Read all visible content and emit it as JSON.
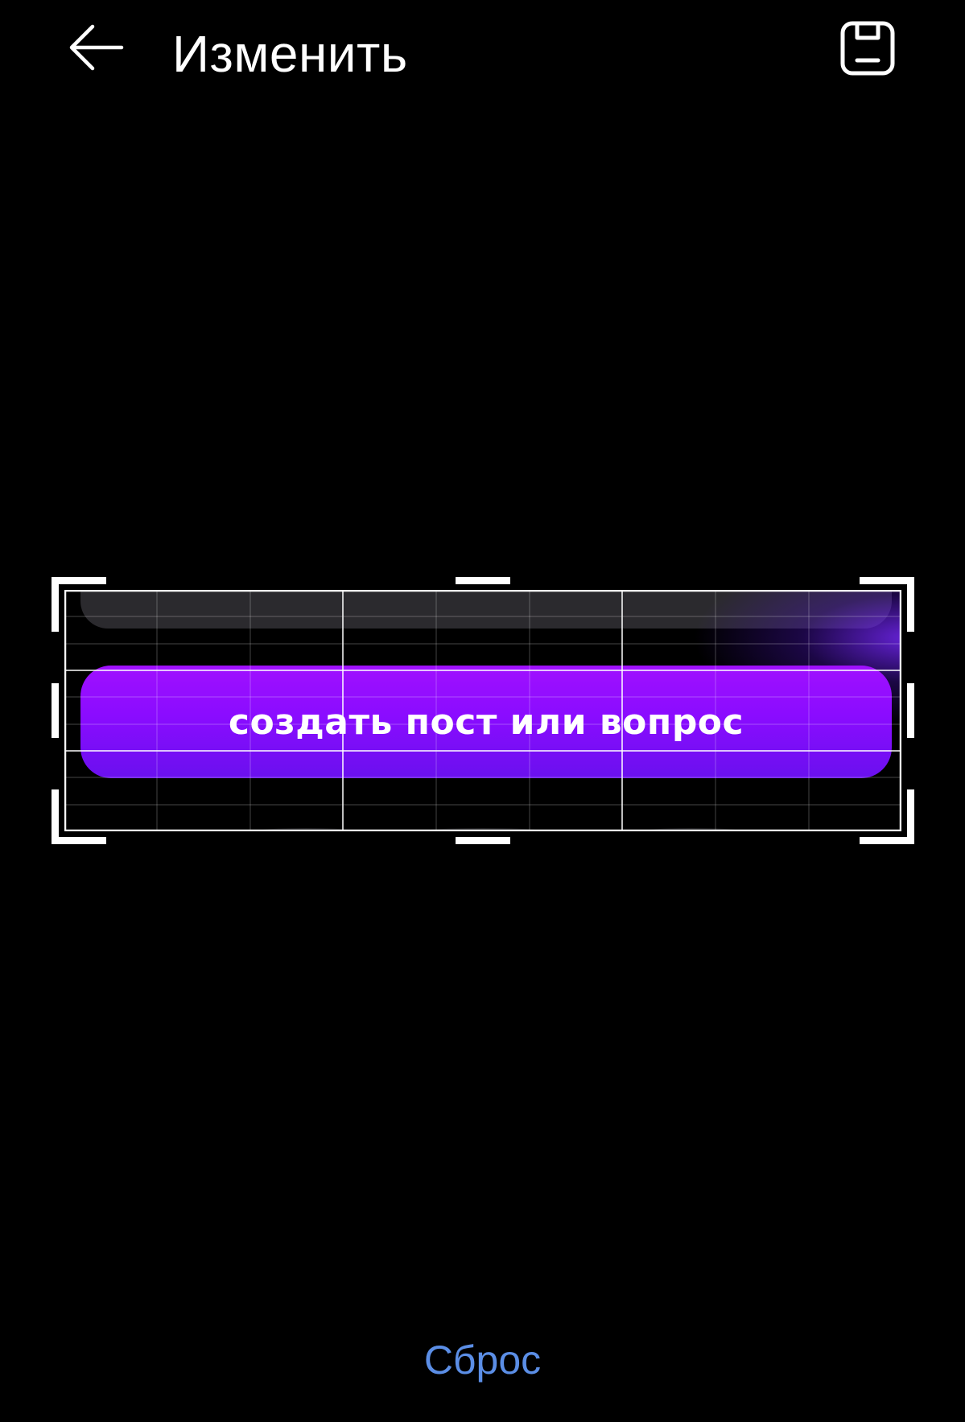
{
  "header": {
    "title": "Изменить",
    "back_icon": "arrow-left-icon",
    "save_icon": "save-icon"
  },
  "crop": {
    "image_button_label": "создать пост или вопрос",
    "accent_color": "#8a0cff",
    "grid": "3x3 with fine subgrid"
  },
  "footer": {
    "reset_label": "Сброс",
    "reset_color": "#5b8ee6"
  }
}
